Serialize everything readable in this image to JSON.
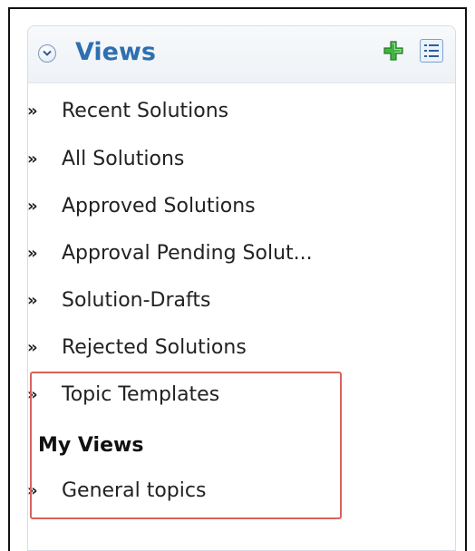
{
  "views_panel": {
    "title": "Views",
    "icons": {
      "collapse": "chevron-down-circle-icon",
      "add": "plus-icon",
      "list": "list-icon"
    },
    "items": [
      {
        "label": "Recent Solutions",
        "bullet": "»"
      },
      {
        "label": "All Solutions",
        "bullet": "»"
      },
      {
        "label": "Approved Solutions",
        "bullet": "»"
      },
      {
        "label": "Approval Pending Solut...",
        "bullet": "»"
      },
      {
        "label": "Solution-Drafts",
        "bullet": "»"
      },
      {
        "label": "Rejected Solutions",
        "bullet": "»"
      },
      {
        "label": "Topic Templates",
        "bullet": "»"
      }
    ]
  },
  "my_views": {
    "heading": "My Views",
    "items": [
      {
        "label": "General topics",
        "bullet": "»"
      }
    ]
  },
  "colors": {
    "title": "#2f6fb0",
    "add_icon": "#3aa83a",
    "highlight": "#d9625c"
  }
}
